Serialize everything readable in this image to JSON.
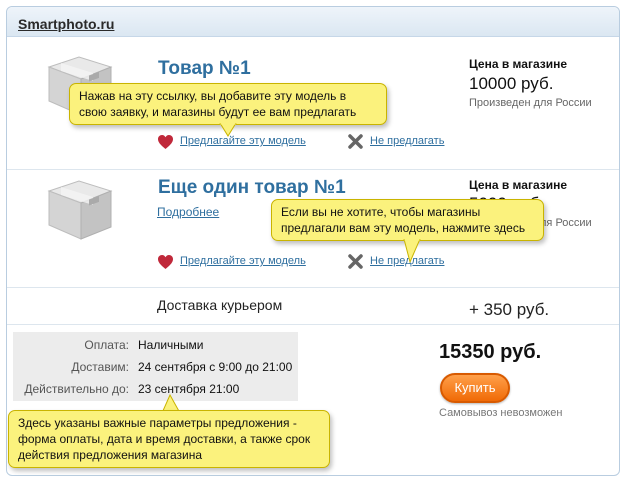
{
  "site_title": "Smartphoto.ru",
  "products": [
    {
      "title": "Товар №1",
      "price_label": "Цена в магазине",
      "price": "10000 руб.",
      "origin": "Произведен для России",
      "more_link": "",
      "suggest_link": "Предлагайте эту модель",
      "decline_link": "Не предлагать"
    },
    {
      "title": "Еще один товар №1",
      "price_label": "Цена в магазине",
      "price": "5000 руб.",
      "origin": "Произведен для России",
      "more_link": "Подробнее",
      "suggest_link": "Предлагайте эту модель",
      "decline_link": "Не предлагать"
    }
  ],
  "delivery": {
    "label": "Доставка курьером",
    "price": "+ 350 руб."
  },
  "order_params": [
    {
      "label": "Оплата:",
      "value": "Наличными"
    },
    {
      "label": "Доставим:",
      "value": "24 сентября с 9:00 до 21:00"
    },
    {
      "label": "Действительно до:",
      "value": "23 сентября 21:00"
    }
  ],
  "total": "15350 руб.",
  "buy_button": "Купить",
  "pickup_note": "Самовывоз невозможен",
  "tooltips": {
    "suggest": "Нажав на эту ссылку, вы добавите эту модель в свою заявку, и магазины будут ее вам предлагать",
    "decline": "Если вы не хотите, чтобы магазины предлагали вам эту модель, нажмите здесь",
    "params": "Здесь указаны важные параметры предложения - форма оплаты, дата и время доставки, а также срок действия предложения магазина"
  },
  "colors": {
    "link": "#2f6f9f",
    "tooltip_bg": "#fbf27d",
    "buy_button": "#f07a12"
  },
  "icons": [
    "box-icon",
    "heart-icon",
    "x-icon"
  ]
}
